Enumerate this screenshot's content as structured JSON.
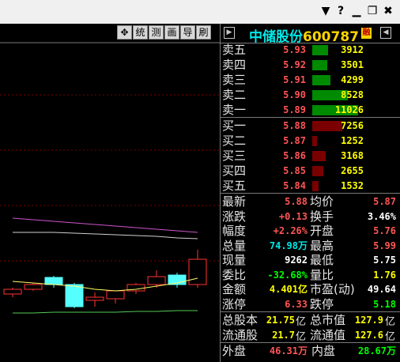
{
  "titlebar": {
    "buttons": [
      {
        "name": "dropdown-icon",
        "glyph": "▼"
      },
      {
        "name": "help-icon",
        "glyph": "?"
      },
      {
        "name": "minimize-icon",
        "glyph": "▁"
      },
      {
        "name": "restore-icon",
        "glyph": "❐"
      },
      {
        "name": "close-icon",
        "glyph": "✖"
      }
    ]
  },
  "chart_toolbar": {
    "move_glyph": "✥",
    "labels": [
      "统",
      "测",
      "画",
      "导",
      "刷"
    ]
  },
  "stock": {
    "name": "中储股份",
    "code": "600787",
    "badge": "融",
    "prev_nav": "▶",
    "next_nav": "◀"
  },
  "order_book": {
    "asks": [
      {
        "label": "卖五",
        "price": "5.93",
        "volume": "3912",
        "fill": 0.35
      },
      {
        "label": "卖四",
        "price": "5.92",
        "volume": "3501",
        "fill": 0.32
      },
      {
        "label": "卖三",
        "price": "5.91",
        "volume": "4299",
        "fill": 0.39
      },
      {
        "label": "卖二",
        "price": "5.90",
        "volume": "8528",
        "fill": 0.77
      },
      {
        "label": "卖一",
        "price": "5.89",
        "volume": "11026",
        "fill": 1.0
      }
    ],
    "bids": [
      {
        "label": "买一",
        "price": "5.88",
        "volume": "7256",
        "fill": 0.66
      },
      {
        "label": "买二",
        "price": "5.87",
        "volume": "1252",
        "fill": 0.11
      },
      {
        "label": "买三",
        "price": "5.86",
        "volume": "3168",
        "fill": 0.29
      },
      {
        "label": "买四",
        "price": "5.85",
        "volume": "2655",
        "fill": 0.24
      },
      {
        "label": "买五",
        "price": "5.84",
        "volume": "1532",
        "fill": 0.14
      }
    ],
    "colors": {
      "ask_price": "#ff5555",
      "bid_price": "#ff5555",
      "ask_bar": "#008a00",
      "bid_bar": "#7a0000",
      "volume": "#ffff00"
    }
  },
  "stats": [
    {
      "l1": "最新",
      "v1": "5.88",
      "c1": "#ff5555",
      "l2": "均价",
      "v2": "5.87",
      "c2": "#ff5555"
    },
    {
      "l1": "涨跌",
      "v1": "+0.13",
      "c1": "#ff5555",
      "l2": "换手",
      "v2": "3.46%",
      "c2": "#ffffff"
    },
    {
      "l1": "幅度",
      "v1": "+2.26%",
      "c1": "#ff5555",
      "l2": "开盘",
      "v2": "5.76",
      "c2": "#ff5555"
    },
    {
      "l1": "总量",
      "v1": "74.98万",
      "c1": "#00e8e8",
      "l2": "最高",
      "v2": "5.99",
      "c2": "#ff5555"
    },
    {
      "l1": "现量",
      "v1": "9262",
      "c1": "#ffffff",
      "l2": "最低",
      "v2": "5.75",
      "c2": "#ffffff"
    },
    {
      "l1": "委比",
      "v1": "-32.68%",
      "c1": "#00ff00",
      "l2": "量比",
      "v2": "1.76",
      "c2": "#ffff00"
    },
    {
      "l1": "金额",
      "v1": "4.401亿",
      "c1": "#ffff00",
      "l2": "市盈(动)",
      "v2": "49.64",
      "c2": "#ffffff"
    },
    {
      "l1": "涨停",
      "v1": "6.33",
      "c1": "#ff5555",
      "l2": "跌停",
      "v2": "5.18",
      "c2": "#00ff00"
    }
  ],
  "market_cap": [
    {
      "l1": "总股本",
      "v1": "21.75",
      "u1": "亿",
      "l2": "总市值",
      "v2": "127.9",
      "u2": "亿"
    },
    {
      "l1": "流通股",
      "v1": "21.7",
      "u1": "亿",
      "l2": "流通值",
      "v2": "127.6",
      "u2": "亿"
    }
  ],
  "market_cap_color": "#ffff00",
  "flow": {
    "outer_label": "外盘",
    "outer_value": "46.31万",
    "outer_color": "#ff5555",
    "inner_label": "内盘",
    "inner_value": "28.67万",
    "inner_color": "#00ff00"
  },
  "chart": {
    "candles": [
      {
        "open": 6,
        "close": 12,
        "low": 2,
        "high": 14
      },
      {
        "open": 12,
        "close": 18,
        "low": 10,
        "high": 20
      },
      {
        "open": 27,
        "close": 18,
        "low": 14,
        "high": 29
      },
      {
        "open": 18,
        "close": -10,
        "low": -12,
        "high": 20
      },
      {
        "open": -2,
        "close": 2,
        "low": -10,
        "high": 8
      },
      {
        "open": 0,
        "close": 10,
        "low": -6,
        "high": 11
      },
      {
        "open": 10,
        "close": 18,
        "low": 6,
        "high": 20
      },
      {
        "open": 18,
        "close": 28,
        "low": 14,
        "high": 36
      },
      {
        "open": 30,
        "close": 18,
        "low": 14,
        "high": 33
      },
      {
        "open": 18,
        "close": 50,
        "low": 14,
        "high": 62
      }
    ],
    "ma_pink": [
      102,
      100,
      98,
      96,
      94,
      92,
      90,
      88,
      86,
      84
    ],
    "ma_white": [
      84,
      84,
      84,
      83,
      82,
      81,
      80,
      79,
      77,
      76
    ],
    "ma_yellow": [
      22,
      20,
      18,
      16,
      12,
      10,
      12,
      16,
      20,
      26
    ],
    "ma_green": [
      -18,
      -18,
      -17,
      -17,
      -17,
      -17,
      -16,
      -16,
      -15,
      -15
    ],
    "colors": {
      "up": "#ff3333",
      "down": "#55ffff",
      "pink": "#cc55cc",
      "white": "#cfcfcf",
      "yellow": "#ffff66",
      "green": "#55cc55",
      "grid": "#7a0000"
    }
  }
}
